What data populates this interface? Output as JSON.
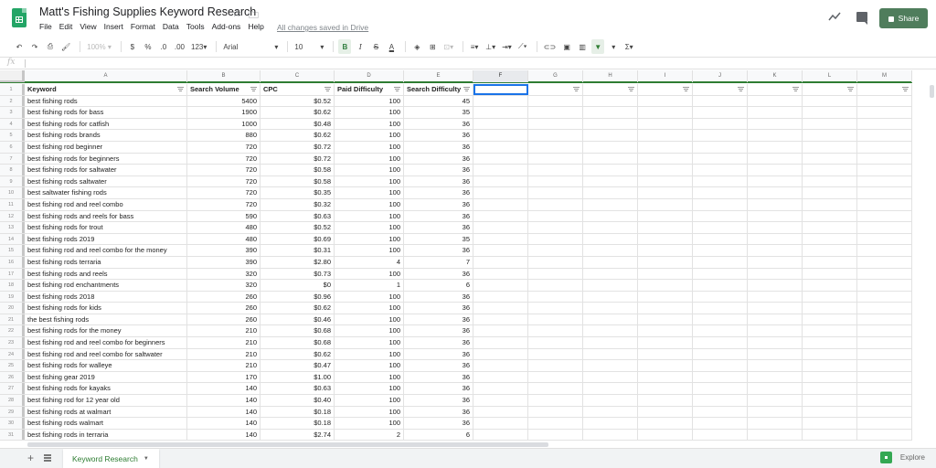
{
  "app": {
    "title": "Matt's Fishing Supplies Keyword Research",
    "save_status": "All changes saved in Drive",
    "share_label": "Share",
    "accent_color": "#4f7d5c"
  },
  "menu": [
    "File",
    "Edit",
    "View",
    "Insert",
    "Format",
    "Data",
    "Tools",
    "Add-ons",
    "Help"
  ],
  "toolbar": {
    "zoom": "100%",
    "currency": "$",
    "percent": "%",
    "decrease_decimal": ".0",
    "increase_decimal": ".00",
    "more_formats": "123",
    "font": "Arial",
    "font_size": "10",
    "bold": "B",
    "italic": "I",
    "strikethrough": "S",
    "text_color": "A",
    "sum": "Σ"
  },
  "formula_bar": {
    "fx_label": "fx",
    "value": ""
  },
  "columns": [
    "A",
    "B",
    "C",
    "D",
    "E",
    "F",
    "G",
    "H",
    "I",
    "J",
    "K",
    "L",
    "M"
  ],
  "selected_column": "F",
  "active_cell": "F1",
  "headers": [
    "Keyword",
    "Search Volume",
    "CPC",
    "Paid Difficulty",
    "Search Difficulty"
  ],
  "rows": [
    [
      "best fishing rods",
      "5400",
      "$0.52",
      "100",
      "45"
    ],
    [
      "best fishing rods for bass",
      "1900",
      "$0.62",
      "100",
      "35"
    ],
    [
      "best fishing rods for catfish",
      "1000",
      "$0.48",
      "100",
      "36"
    ],
    [
      "best fishing rods brands",
      "880",
      "$0.62",
      "100",
      "36"
    ],
    [
      "best fishing rod beginner",
      "720",
      "$0.72",
      "100",
      "36"
    ],
    [
      "best fishing rods for beginners",
      "720",
      "$0.72",
      "100",
      "36"
    ],
    [
      "best fishing rods for saltwater",
      "720",
      "$0.58",
      "100",
      "36"
    ],
    [
      "best fishing rods saltwater",
      "720",
      "$0.58",
      "100",
      "36"
    ],
    [
      "best saltwater fishing rods",
      "720",
      "$0.35",
      "100",
      "36"
    ],
    [
      "best fishing rod and reel combo",
      "720",
      "$0.32",
      "100",
      "36"
    ],
    [
      "best fishing rods and reels for bass",
      "590",
      "$0.63",
      "100",
      "36"
    ],
    [
      "best fishing rods for trout",
      "480",
      "$0.52",
      "100",
      "36"
    ],
    [
      "best fishing rods 2019",
      "480",
      "$0.69",
      "100",
      "35"
    ],
    [
      "best fishing rod and reel combo for the money",
      "390",
      "$0.31",
      "100",
      "36"
    ],
    [
      "best fishing rods terraria",
      "390",
      "$2.80",
      "4",
      "7"
    ],
    [
      "best fishing rods and reels",
      "320",
      "$0.73",
      "100",
      "36"
    ],
    [
      "best fishing rod enchantments",
      "320",
      "$0",
      "1",
      "6"
    ],
    [
      "best fishing rods 2018",
      "260",
      "$0.96",
      "100",
      "36"
    ],
    [
      "best fishing rods for kids",
      "260",
      "$0.62",
      "100",
      "36"
    ],
    [
      "the best fishing rods",
      "260",
      "$0.46",
      "100",
      "36"
    ],
    [
      "best fishing rods for the money",
      "210",
      "$0.68",
      "100",
      "36"
    ],
    [
      "best fishing rod and reel combo for beginners",
      "210",
      "$0.68",
      "100",
      "36"
    ],
    [
      "best fishing rod and reel combo for saltwater",
      "210",
      "$0.62",
      "100",
      "36"
    ],
    [
      "best fishing rods for walleye",
      "210",
      "$0.47",
      "100",
      "36"
    ],
    [
      "best fishing gear 2019",
      "170",
      "$1.00",
      "100",
      "36"
    ],
    [
      "best fishing rods for kayaks",
      "140",
      "$0.63",
      "100",
      "36"
    ],
    [
      "best fishing rod for 12 year old",
      "140",
      "$0.40",
      "100",
      "36"
    ],
    [
      "best fishing rods at walmart",
      "140",
      "$0.18",
      "100",
      "36"
    ],
    [
      "best fishing rods walmart",
      "140",
      "$0.18",
      "100",
      "36"
    ],
    [
      "best fishing rods in terraria",
      "140",
      "$2.74",
      "2",
      "6"
    ]
  ],
  "sheets": {
    "add_label": "+",
    "active_tab": "Keyword Research"
  },
  "explore_label": "Explore"
}
